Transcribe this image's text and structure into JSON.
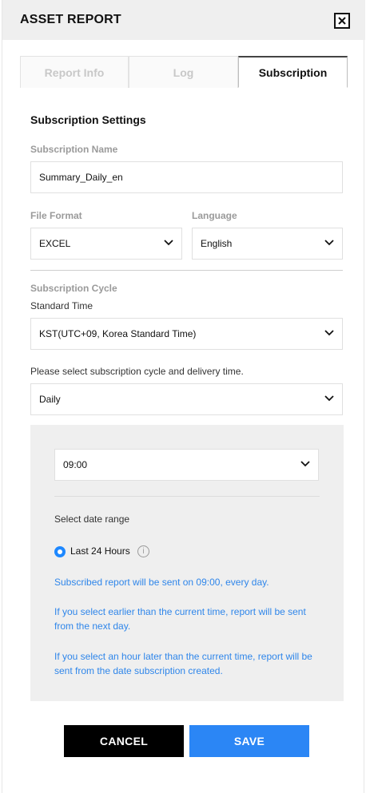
{
  "header": {
    "title": "ASSET REPORT",
    "close_icon": "close-icon"
  },
  "tabs": [
    {
      "label": "Report Info",
      "active": false
    },
    {
      "label": "Log",
      "active": false
    },
    {
      "label": "Subscription",
      "active": true
    }
  ],
  "subscription_settings": {
    "title": "Subscription Settings",
    "name_label": "Subscription Name",
    "name_value": "Summary_Daily_en",
    "file_format_label": "File Format",
    "file_format_value": "EXCEL",
    "language_label": "Language",
    "language_value": "English"
  },
  "subscription_cycle": {
    "title": "Subscription Cycle",
    "standard_time_label": "Standard Time",
    "standard_time_value": "KST(UTC+09, Korea Standard Time)",
    "cycle_prompt": "Please select subscription cycle and delivery time.",
    "cycle_value": "Daily",
    "time_value": "09:00",
    "date_range_label": "Select date range",
    "date_range_option": "Last 24 Hours",
    "notes": [
      "Subscribed report will be sent on 09:00, every day.",
      "If you select earlier than the current time, report will be sent from the next day.",
      "If you select an hour later than the current time, report will be sent from the date subscription created."
    ]
  },
  "actions": {
    "cancel_label": "CANCEL",
    "save_label": "SAVE"
  },
  "colors": {
    "accent": "#2b86f5",
    "note_text": "#2f86ea",
    "header_bg": "#efefef",
    "cancel_bg": "#000000"
  }
}
